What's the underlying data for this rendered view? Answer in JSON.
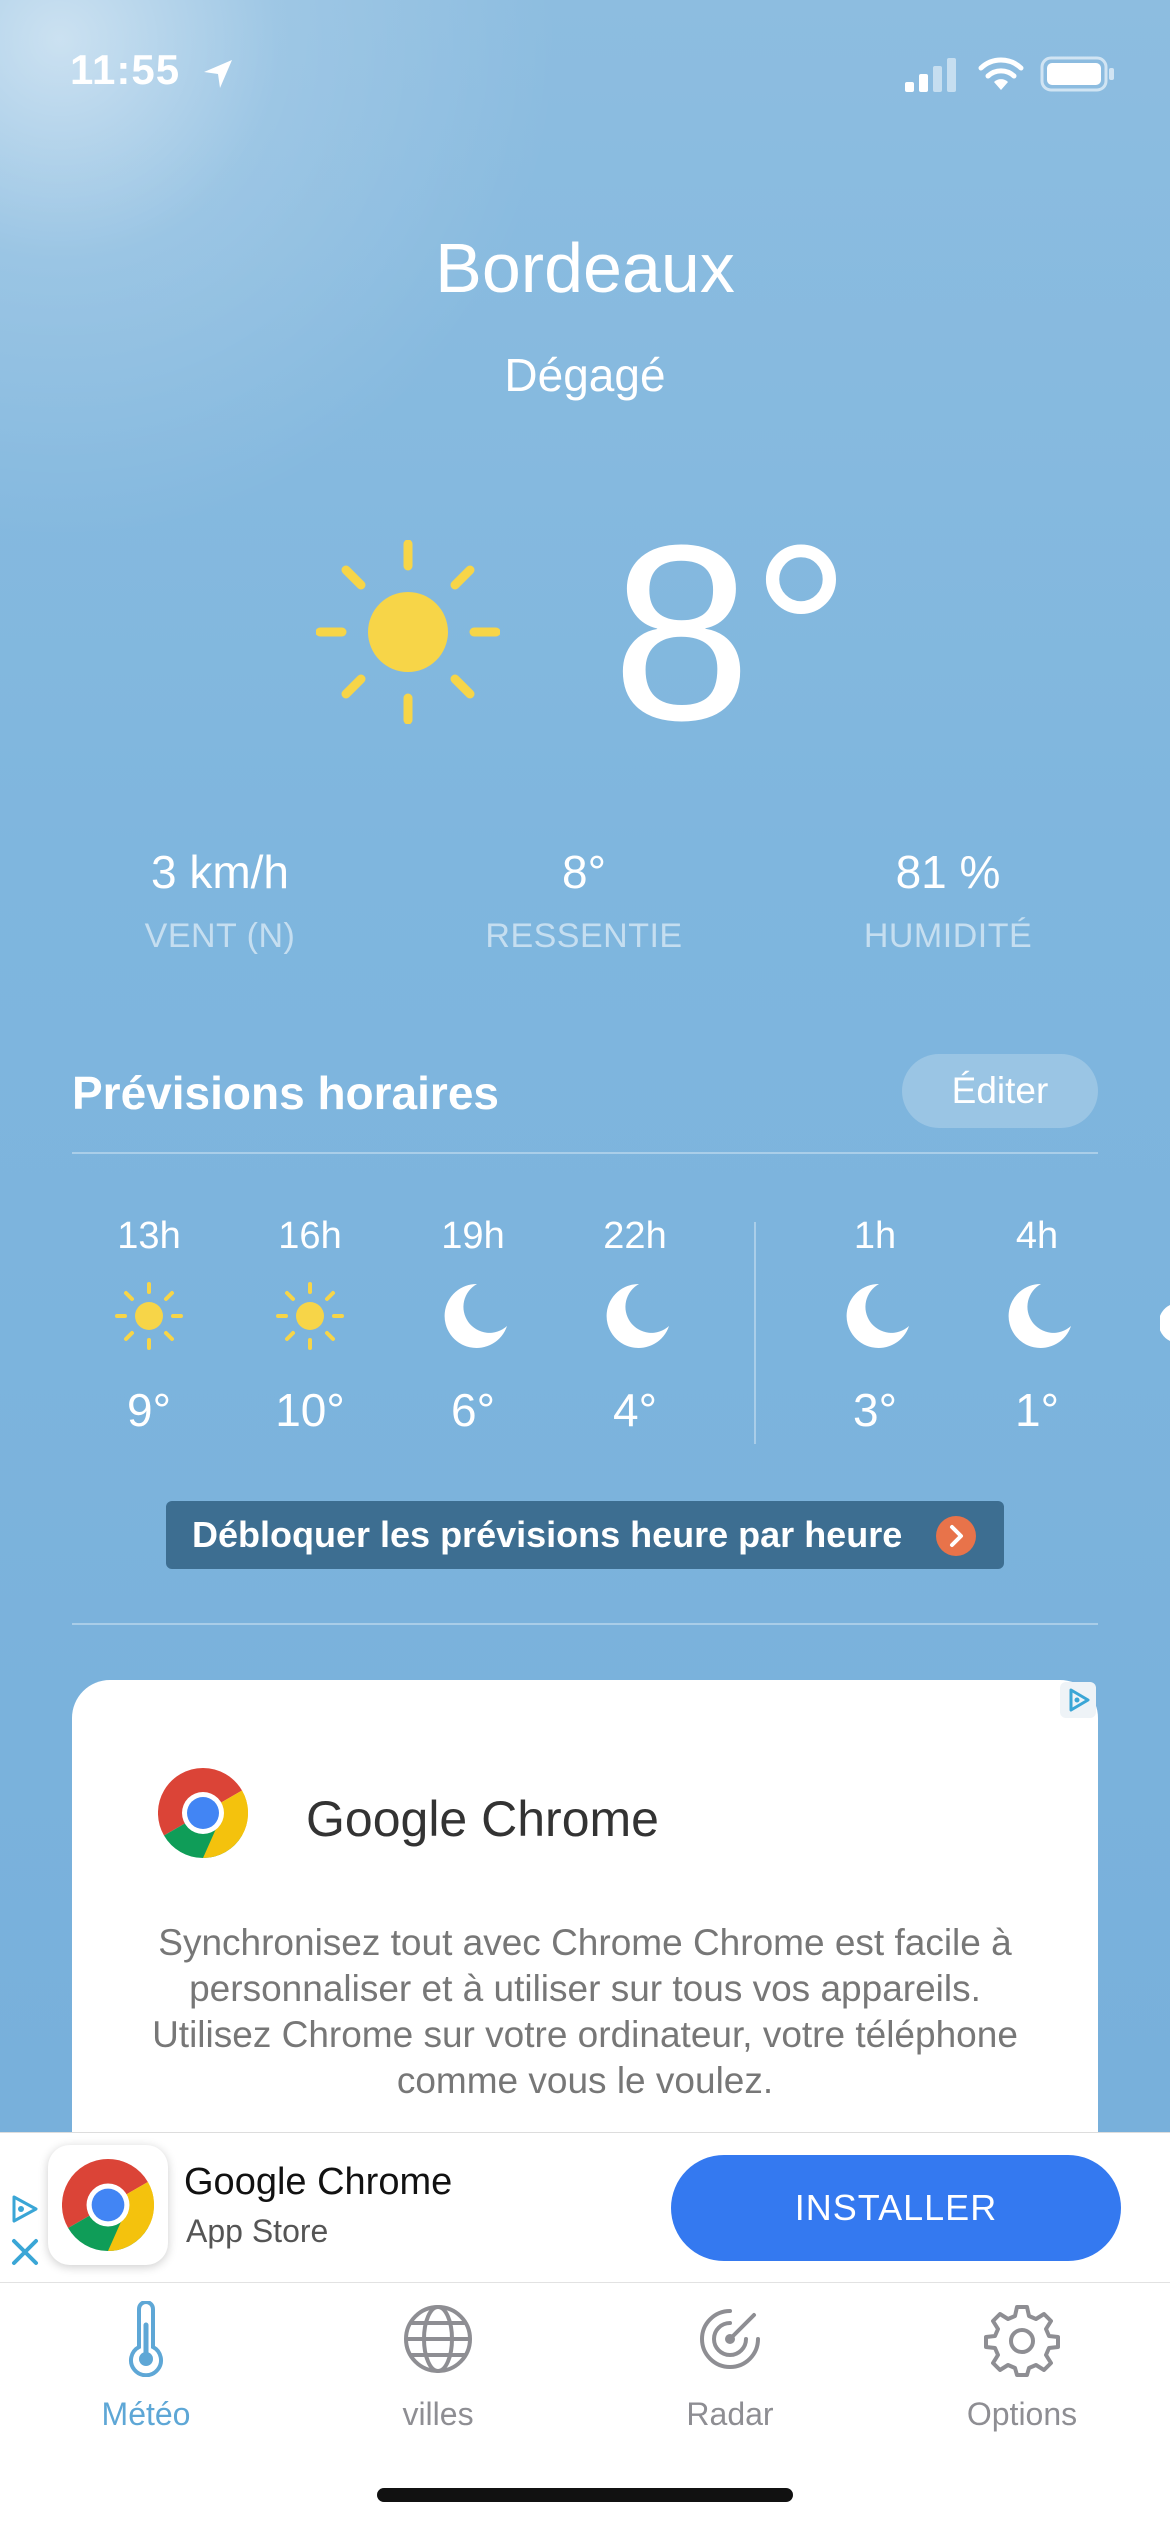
{
  "status_bar": {
    "time": "11:55",
    "icons": [
      "location-arrow-icon",
      "signal-icon",
      "wifi-icon",
      "battery-icon"
    ]
  },
  "weather": {
    "city": "Bordeaux",
    "condition": "Dégagé",
    "temperature": "8°",
    "icon": "sun-icon",
    "stats": [
      {
        "value": "3 km/h",
        "label": "VENT (N)"
      },
      {
        "value": "8°",
        "label": "RESSENTIE"
      },
      {
        "value": "81 %",
        "label": "HUMIDITÉ"
      }
    ]
  },
  "hourly": {
    "title": "Prévisions horaires",
    "edit_label": "Éditer",
    "items": [
      {
        "hour": "13h",
        "icon": "sun-icon",
        "temp": "9°"
      },
      {
        "hour": "16h",
        "icon": "sun-icon",
        "temp": "10°"
      },
      {
        "hour": "19h",
        "icon": "moon-icon",
        "temp": "6°"
      },
      {
        "hour": "22h",
        "icon": "moon-icon",
        "temp": "4°"
      },
      {
        "hour": "1h",
        "icon": "moon-icon",
        "temp": "3°"
      },
      {
        "hour": "4h",
        "icon": "moon-icon",
        "temp": "1°"
      }
    ],
    "unlock_label": "Débloquer les prévisions heure par heure"
  },
  "ad_card": {
    "title": "Google Chrome",
    "description": "Synchronisez tout avec Chrome Chrome est facile à personnaliser et à utiliser sur tous vos appareils. Utilisez Chrome sur votre ordinateur, votre téléphone comme vous le voulez."
  },
  "ad_banner": {
    "app_name": "Google Chrome",
    "store": "App Store",
    "install_label": "INSTALLER"
  },
  "tabbar": {
    "tabs": [
      {
        "label": "Météo",
        "icon": "thermometer-icon",
        "active": true
      },
      {
        "label": "villes",
        "icon": "globe-icon",
        "active": false
      },
      {
        "label": "Radar",
        "icon": "radar-icon",
        "active": false
      },
      {
        "label": "Options",
        "icon": "gear-icon",
        "active": false
      }
    ]
  },
  "colors": {
    "sky": "#7fb5dc",
    "sun": "#f7d548",
    "accent": "#5ea7d6",
    "install": "#3479f0",
    "unlock_bg": "#3d6e91",
    "unlock_arrow": "#e8734a"
  }
}
